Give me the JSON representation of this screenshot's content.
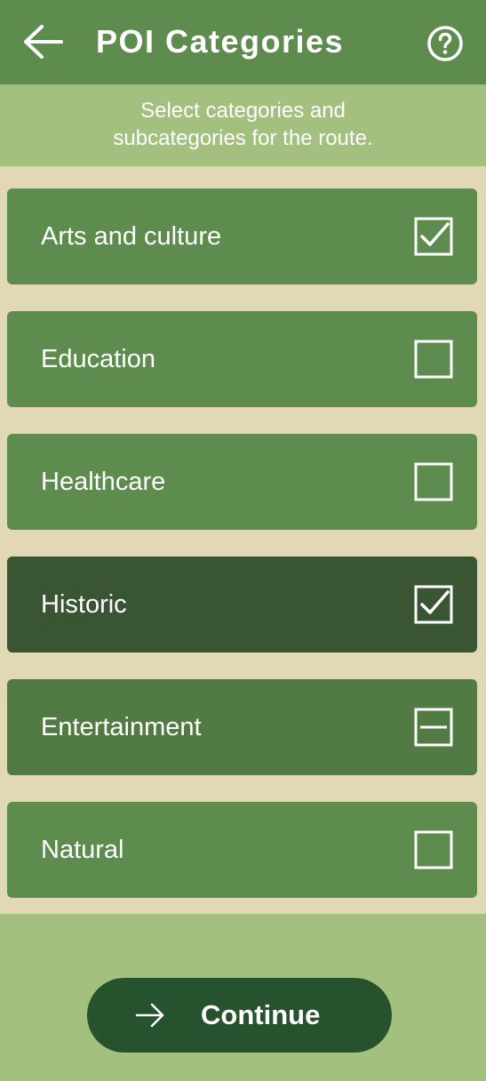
{
  "header": {
    "title": "POI Categories",
    "back_icon": "arrow-left-icon",
    "help_icon": "help-circle-icon"
  },
  "subheader": {
    "line1": "Select categories and",
    "line2": "subcategories for the route."
  },
  "categories": [
    {
      "label": "Arts and culture",
      "state": "checked"
    },
    {
      "label": "Education",
      "state": "unchecked"
    },
    {
      "label": "Healthcare",
      "state": "unchecked"
    },
    {
      "label": "Historic",
      "state": "checked"
    },
    {
      "label": "Entertainment",
      "state": "partial"
    },
    {
      "label": "Natural",
      "state": "unchecked"
    }
  ],
  "footer": {
    "continue_label": "Continue",
    "continue_icon": "arrow-right-icon"
  },
  "colors": {
    "header": "#5d8c4e",
    "subheader": "#a4c07e",
    "background": "#e3d8b6",
    "item_default": "#5d8c4e",
    "item_checked": "#3a5533",
    "item_partial": "#527a43",
    "button": "#26522e"
  }
}
